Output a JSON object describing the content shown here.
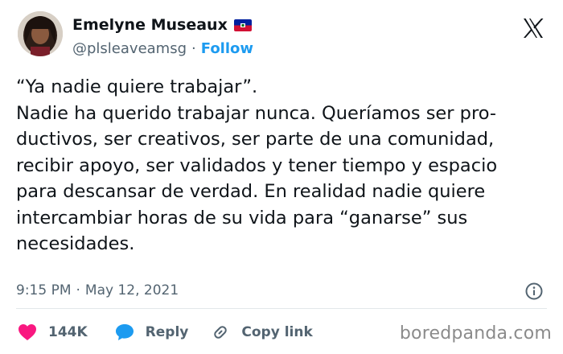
{
  "author": {
    "display_name": "Emelyne Museaux",
    "handle": "@plsleaveamsg",
    "separator": "·",
    "follow_label": "Follow",
    "flag_icon": "haiti-flag-icon",
    "avatar_icon": "avatar"
  },
  "platform_icon": "x-logo-icon",
  "tweet": {
    "lines": [
      "“Ya nadie quiere trabajar”.",
      "Nadie ha querido trabajar nunca. Queríamos ser pro-",
      "ductivos, ser creativos, ser parte de una comunidad,",
      "recibir apoyo, ser validados y tener tiempo y espacio",
      "para descansar de verdad. En realidad nadie quiere",
      "intercambiar horas de su vida para “ganarse” sus",
      "necesidades."
    ]
  },
  "meta": {
    "time": "9:15 PM",
    "separator": "·",
    "date": "May 12, 2021",
    "info_icon": "info-icon"
  },
  "actions": {
    "like_count": "144K",
    "reply_label": "Reply",
    "copy_label": "Copy link"
  },
  "colors": {
    "accent": "#1d9bf0",
    "like": "#f91880",
    "muted": "#536471",
    "text": "#0f1419"
  },
  "watermark": "boredpanda.com"
}
